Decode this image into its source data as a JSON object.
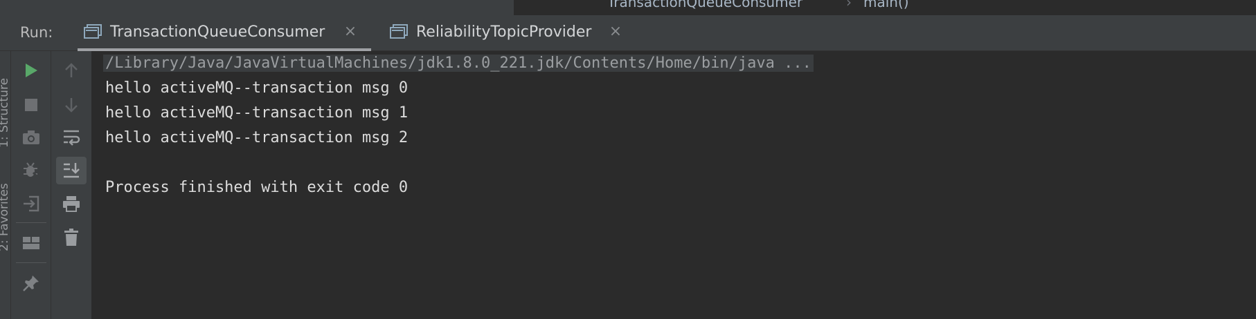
{
  "editor": {
    "breadcrumb_class": "TransactionQueueConsumer",
    "breadcrumb_separator": "›",
    "breadcrumb_method": "main()"
  },
  "run_panel": {
    "label": "Run:",
    "tabs": [
      {
        "label": "TransactionQueueConsumer",
        "active": true,
        "icon": "console-icon"
      },
      {
        "label": "ReliabilityTopicProvider",
        "active": false,
        "icon": "console-icon"
      }
    ],
    "close_glyph": "×"
  },
  "side_stripe": {
    "labels": [
      "1: Structure",
      "2: Favorites"
    ]
  },
  "toolbar_left": {
    "buttons": [
      "rerun-icon",
      "stop-icon",
      "camera-icon",
      "debug-off-icon",
      "restore-layout-icon",
      "layout-icon",
      "pin-icon"
    ]
  },
  "toolbar_right": {
    "buttons": [
      "up-arrow-icon",
      "down-arrow-icon",
      "soft-wrap-icon",
      "scroll-to-end-icon",
      "print-icon",
      "trash-icon"
    ]
  },
  "console": {
    "lines": [
      "/Library/Java/JavaVirtualMachines/jdk1.8.0_221.jdk/Contents/Home/bin/java ...",
      "hello activeMQ--transaction msg 0",
      "hello activeMQ--transaction msg 1",
      "hello activeMQ--transaction msg 2",
      "",
      "Process finished with exit code 0"
    ]
  },
  "colors": {
    "run_green": "#59a869",
    "background": "#2b2b2b",
    "panel": "#3c3f41"
  }
}
